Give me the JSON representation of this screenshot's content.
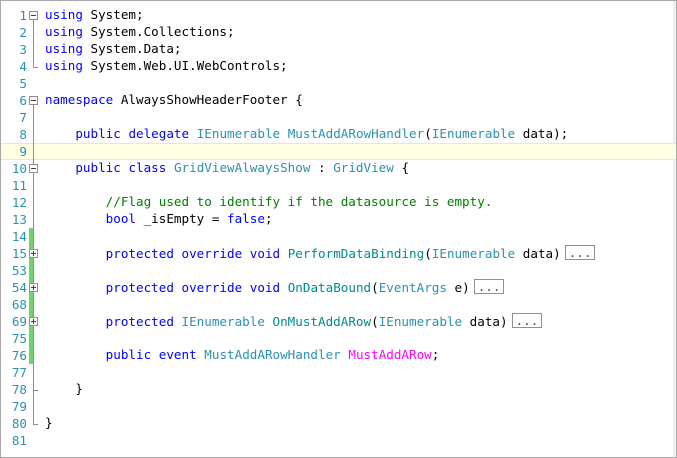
{
  "editor": {
    "lines": [
      {
        "n": "1",
        "tokens": [
          {
            "t": "using",
            "c": "kw"
          },
          {
            "t": " System;"
          }
        ]
      },
      {
        "n": "2",
        "tokens": [
          {
            "t": "using",
            "c": "kw"
          },
          {
            "t": " System.Collections;"
          }
        ]
      },
      {
        "n": "3",
        "tokens": [
          {
            "t": "using",
            "c": "kw"
          },
          {
            "t": " System.Data;"
          }
        ]
      },
      {
        "n": "4",
        "tokens": [
          {
            "t": "using",
            "c": "kw"
          },
          {
            "t": " System.Web.UI.WebControls;"
          }
        ]
      },
      {
        "n": "5",
        "tokens": []
      },
      {
        "n": "6",
        "tokens": [
          {
            "t": "namespace",
            "c": "kw"
          },
          {
            "t": " AlwaysShowHeaderFooter {"
          }
        ]
      },
      {
        "n": "7",
        "tokens": []
      },
      {
        "n": "8",
        "tokens": [
          {
            "t": "    "
          },
          {
            "t": "public",
            "c": "kw"
          },
          {
            "t": " "
          },
          {
            "t": "delegate",
            "c": "kw"
          },
          {
            "t": " "
          },
          {
            "t": "IEnumerable",
            "c": "ty"
          },
          {
            "t": " "
          },
          {
            "t": "MustAddARowHandler",
            "c": "ty"
          },
          {
            "t": "("
          },
          {
            "t": "IEnumerable",
            "c": "ty"
          },
          {
            "t": " data);"
          }
        ]
      },
      {
        "n": "9",
        "tokens": [],
        "current": true
      },
      {
        "n": "10",
        "tokens": [
          {
            "t": "    "
          },
          {
            "t": "public",
            "c": "kw"
          },
          {
            "t": " "
          },
          {
            "t": "class",
            "c": "kw"
          },
          {
            "t": " "
          },
          {
            "t": "GridViewAlwaysShow",
            "c": "ty"
          },
          {
            "t": " : "
          },
          {
            "t": "GridView",
            "c": "ty"
          },
          {
            "t": " {"
          }
        ]
      },
      {
        "n": "11",
        "tokens": []
      },
      {
        "n": "12",
        "tokens": [
          {
            "t": "        "
          },
          {
            "t": "//Flag used to identify if the datasource is empty.",
            "c": "cm"
          }
        ]
      },
      {
        "n": "13",
        "tokens": [
          {
            "t": "        "
          },
          {
            "t": "bool",
            "c": "kw"
          },
          {
            "t": " _isEmpty = "
          },
          {
            "t": "false",
            "c": "kw"
          },
          {
            "t": ";"
          }
        ]
      },
      {
        "n": "14",
        "tokens": []
      },
      {
        "n": "15",
        "tokens": [
          {
            "t": "        "
          },
          {
            "t": "protected",
            "c": "kw"
          },
          {
            "t": " "
          },
          {
            "t": "override",
            "c": "kw"
          },
          {
            "t": " "
          },
          {
            "t": "void",
            "c": "kw"
          },
          {
            "t": " "
          },
          {
            "t": "PerformDataBinding",
            "c": "mth"
          },
          {
            "t": "("
          },
          {
            "t": "IEnumerable",
            "c": "ty"
          },
          {
            "t": " data)"
          }
        ],
        "collapsed": "..."
      },
      {
        "n": "53",
        "tokens": []
      },
      {
        "n": "54",
        "tokens": [
          {
            "t": "        "
          },
          {
            "t": "protected",
            "c": "kw"
          },
          {
            "t": " "
          },
          {
            "t": "override",
            "c": "kw"
          },
          {
            "t": " "
          },
          {
            "t": "void",
            "c": "kw"
          },
          {
            "t": " "
          },
          {
            "t": "OnDataBound",
            "c": "mth"
          },
          {
            "t": "("
          },
          {
            "t": "EventArgs",
            "c": "ty"
          },
          {
            "t": " e)"
          }
        ],
        "collapsed": "..."
      },
      {
        "n": "68",
        "tokens": []
      },
      {
        "n": "69",
        "tokens": [
          {
            "t": "        "
          },
          {
            "t": "protected",
            "c": "kw"
          },
          {
            "t": " "
          },
          {
            "t": "IEnumerable",
            "c": "ty"
          },
          {
            "t": " "
          },
          {
            "t": "OnMustAddARow",
            "c": "mth"
          },
          {
            "t": "("
          },
          {
            "t": "IEnumerable",
            "c": "ty"
          },
          {
            "t": " data)"
          }
        ],
        "collapsed": "..."
      },
      {
        "n": "75",
        "tokens": []
      },
      {
        "n": "76",
        "tokens": [
          {
            "t": "        "
          },
          {
            "t": "public",
            "c": "kw"
          },
          {
            "t": " "
          },
          {
            "t": "event",
            "c": "kw"
          },
          {
            "t": " "
          },
          {
            "t": "MustAddARowHandler",
            "c": "ty"
          },
          {
            "t": " "
          },
          {
            "t": "MustAddARow",
            "c": "evt"
          },
          {
            "t": ";"
          }
        ]
      },
      {
        "n": "77",
        "tokens": []
      },
      {
        "n": "78",
        "tokens": [
          {
            "t": "    }"
          }
        ]
      },
      {
        "n": "79",
        "tokens": []
      },
      {
        "n": "80",
        "tokens": [
          {
            "t": "}"
          }
        ]
      },
      {
        "n": "81",
        "tokens": []
      }
    ],
    "colors": {
      "keyword": "#0000ff",
      "type": "#2b91af",
      "method": "#008b8b",
      "comment": "#008000",
      "event": "#ff00ff",
      "line_number": "#2b91af",
      "current_line": "#ffffe4",
      "changed_margin": "#6fd46f"
    }
  }
}
